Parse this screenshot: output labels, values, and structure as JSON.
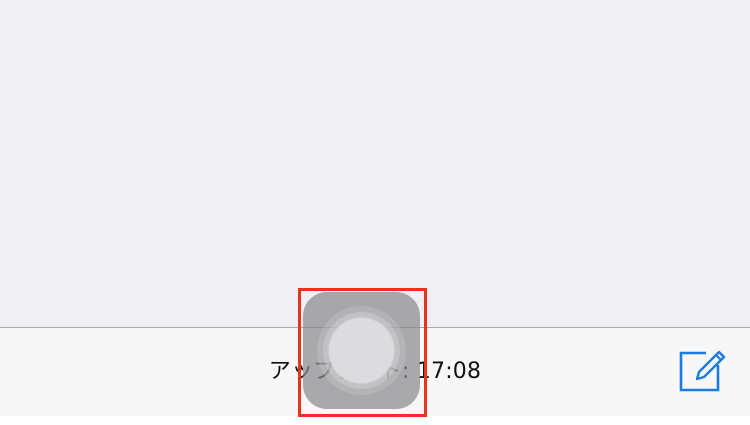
{
  "toolbar": {
    "status_text": "アップデート: 17:08",
    "compose_icon": "compose-icon",
    "accent_color": "#1a7ce0"
  },
  "assistive_touch": {
    "icon": "assistive-touch-icon"
  },
  "annotation": {
    "color": "#e8341c"
  }
}
